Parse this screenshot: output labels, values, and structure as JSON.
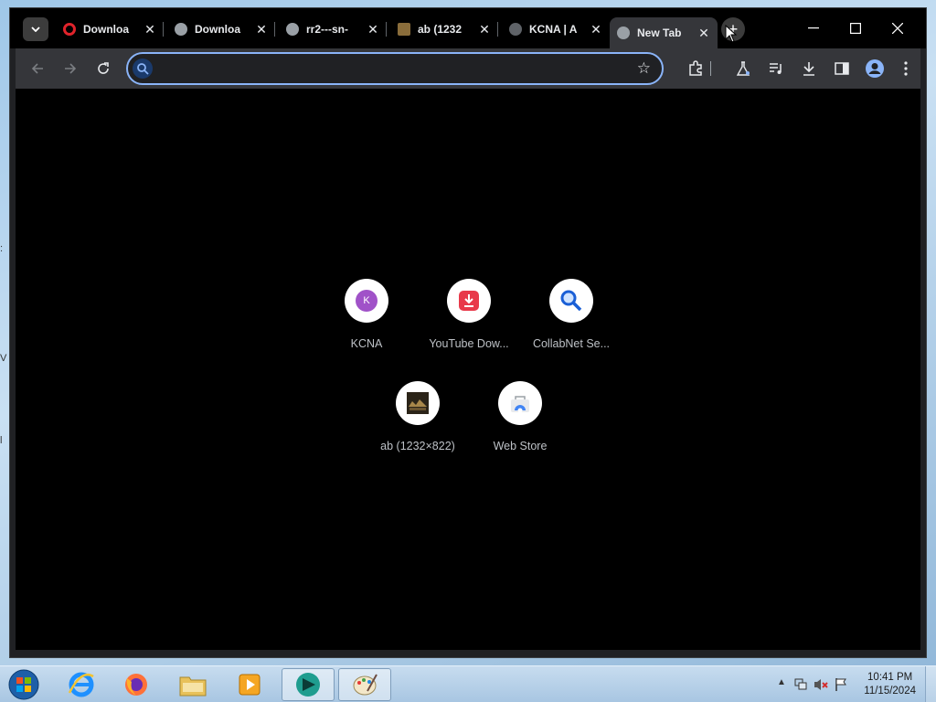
{
  "browser": {
    "tabs": [
      {
        "title": "Downloa",
        "favicon": "opera-icon",
        "color": "#e0232b"
      },
      {
        "title": "Downloa",
        "favicon": "globe-icon",
        "color": "#9aa0a6"
      },
      {
        "title": "rr2---sn-",
        "favicon": "globe-icon",
        "color": "#9aa0a6"
      },
      {
        "title": "ab (1232",
        "favicon": "image-thumb-icon",
        "color": "#8a6d3b"
      },
      {
        "title": "KCNA | A",
        "favicon": "kcna-icon",
        "color": "#9aa0a6"
      },
      {
        "title": "New Tab",
        "favicon": "globe-icon",
        "color": "#9aa0a6"
      }
    ],
    "omnibox": {
      "value": "",
      "placeholder": ""
    },
    "shortcuts": [
      {
        "label": "KCNA",
        "icon": "kcna-letter-icon",
        "letter": "K",
        "color": "#a052c8"
      },
      {
        "label": "YouTube Dow...",
        "icon": "download-red-icon",
        "color": "#e8394a"
      },
      {
        "label": "CollabNet Se...",
        "icon": "magnifier-icon",
        "color": "#1a5fd6"
      },
      {
        "label": "ab (1232×822)",
        "icon": "image-thumb-icon",
        "color": "#4a3a20"
      },
      {
        "label": "Web Store",
        "icon": "webstore-icon",
        "color": "#4285f4"
      }
    ]
  },
  "taskbar": {
    "clock_time": "10:41 PM",
    "clock_date": "11/15/2024"
  }
}
